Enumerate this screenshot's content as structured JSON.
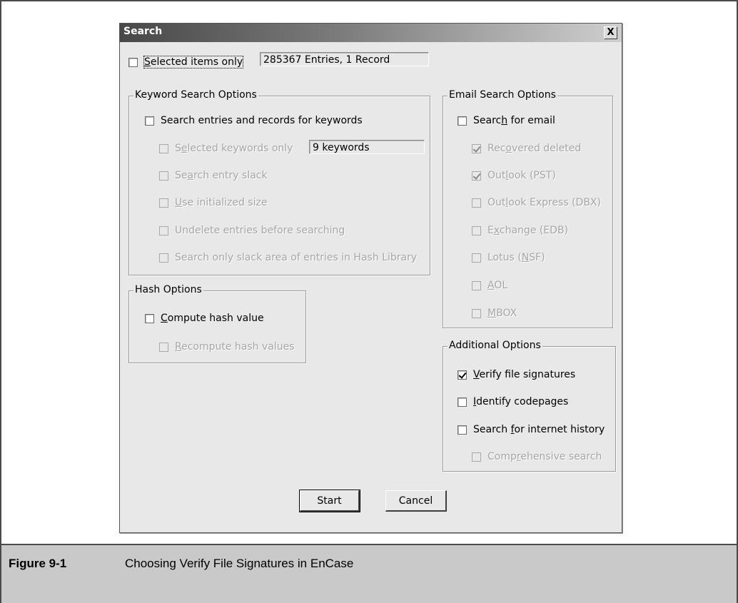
{
  "dialog": {
    "title": "Search",
    "close_glyph": "X",
    "selected_items_only": {
      "label_pre": "",
      "label_u": "S",
      "label_post": "elected items only",
      "checked": false
    },
    "entries_display": "285367 Entries, 1 Record",
    "start_label": "Start",
    "cancel_label": "Cancel"
  },
  "keyword_group": {
    "legend": "Keyword Search Options",
    "search_entries": {
      "text": "Search entries and records for keywords",
      "checked": false
    },
    "selected_keywords": {
      "pre": "S",
      "u": "e",
      "post": "lected keywords only",
      "checked": false
    },
    "keywords_display": "9 keywords",
    "search_entry_slack": {
      "pre": "Se",
      "u": "a",
      "post": "rch entry slack",
      "checked": false
    },
    "use_initialized_size": {
      "pre": "",
      "u": "U",
      "post": "se initialized size",
      "checked": false
    },
    "undelete_entries": {
      "text": "Undelete entries before searching",
      "checked": false
    },
    "search_only_slack": {
      "text": "Search only slack area of entries in Hash Library",
      "checked": false
    }
  },
  "hash_group": {
    "legend": "Hash Options",
    "compute_hash": {
      "pre": "",
      "u": "C",
      "post": "ompute hash value",
      "checked": false
    },
    "recompute_hash": {
      "pre": "",
      "u": "R",
      "post": "ecompute hash values",
      "checked": false
    }
  },
  "email_group": {
    "legend": "Email Search Options",
    "search_email": {
      "pre": "Searc",
      "u": "h",
      "post": " for email",
      "checked": false
    },
    "recovered_deleted": {
      "pre": "Rec",
      "u": "o",
      "post": "vered deleted",
      "checked": true
    },
    "outlook_pst": {
      "pre": "Out",
      "u": "l",
      "post": "ook (PST)",
      "checked": true
    },
    "outlook_express": {
      "pre": "Out",
      "u": "l",
      "post": "ook Express (DBX)",
      "checked": false
    },
    "exchange": {
      "pre": "E",
      "u": "x",
      "post": "change (EDB)",
      "checked": false
    },
    "lotus": {
      "pre": "Lotus (",
      "u": "N",
      "post": "SF)",
      "checked": false
    },
    "aol": {
      "pre": "",
      "u": "A",
      "post": "OL",
      "checked": false
    },
    "mbox": {
      "pre": "",
      "u": "M",
      "post": "BOX",
      "checked": false
    }
  },
  "additional_group": {
    "legend": "Additional Options",
    "verify_signatures": {
      "pre": "",
      "u": "V",
      "post": "erify file signatures",
      "checked": true
    },
    "identify_codepages": {
      "pre": "",
      "u": "I",
      "post": "dentify codepages",
      "checked": false
    },
    "internet_history": {
      "pre": "Search ",
      "u": "f",
      "post": "or internet history",
      "checked": false
    },
    "comprehensive": {
      "pre": "Comp",
      "u": "r",
      "post": "ehensive search",
      "checked": false
    }
  },
  "caption": {
    "figure_number": "Figure 9-1",
    "text": "Choosing Verify File Signatures in EnCase"
  }
}
